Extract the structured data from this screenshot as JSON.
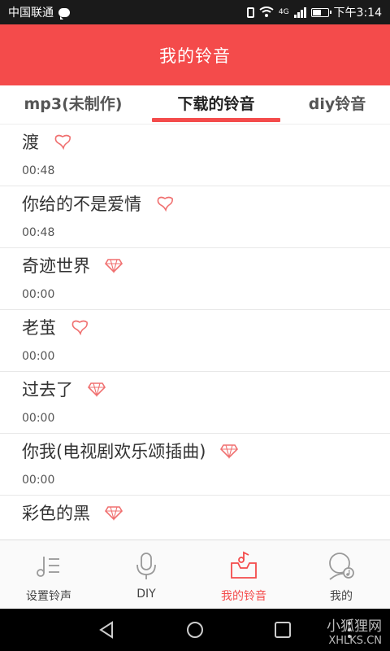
{
  "status_bar": {
    "carrier": "中国联通",
    "network_label": "4G",
    "time": "下午3:14"
  },
  "header": {
    "title": "我的铃音"
  },
  "tabs": [
    {
      "label": "mp3(未制作)",
      "active": false
    },
    {
      "label": "下载的铃音",
      "active": true
    },
    {
      "label": "diy铃音",
      "active": false
    }
  ],
  "ringtones": [
    {
      "title": "渡",
      "duration": "00:48",
      "badge_icon": "heart-badge-icon"
    },
    {
      "title": "你给的不是爱情",
      "duration": "00:48",
      "badge_icon": "heart-badge-icon"
    },
    {
      "title": "奇迹世界",
      "duration": "00:00",
      "badge_icon": "diamond-icon"
    },
    {
      "title": "老茧",
      "duration": "00:00",
      "badge_icon": "heart-badge-icon"
    },
    {
      "title": "过去了",
      "duration": "00:00",
      "badge_icon": "diamond-icon"
    },
    {
      "title": "你我(电视剧欢乐颂插曲)",
      "duration": "00:00",
      "badge_icon": "diamond-icon"
    },
    {
      "title": "彩色的黑",
      "duration": "",
      "badge_icon": "diamond-icon"
    }
  ],
  "bottom_nav": [
    {
      "label": "设置铃声",
      "icon": "music-note-icon",
      "active": false
    },
    {
      "label": "DIY",
      "icon": "microphone-icon",
      "active": false
    },
    {
      "label": "我的铃音",
      "icon": "music-box-icon",
      "active": true
    },
    {
      "label": "我的",
      "icon": "user-music-icon",
      "active": false
    }
  ],
  "colors": {
    "accent": "#f44b4b",
    "status_bar": "#1a1a1a"
  },
  "watermark": {
    "line1": "小狐狸网",
    "line2": "XHLKS.CN"
  }
}
